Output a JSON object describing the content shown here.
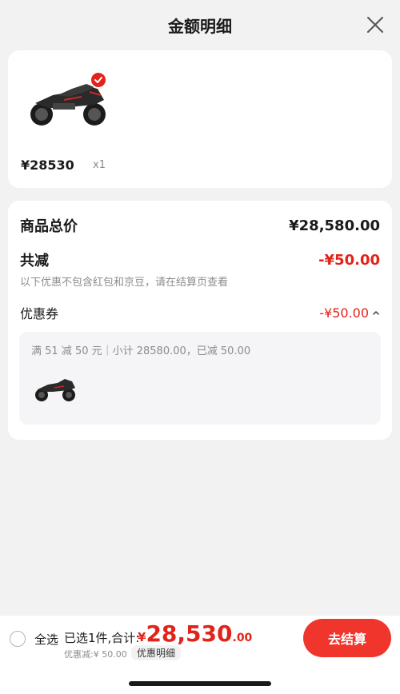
{
  "header": {
    "title": "金额明细"
  },
  "product": {
    "price": "¥28530",
    "qty": "x1",
    "image_icon": "motorcycle-image"
  },
  "summary": {
    "total_label": "商品总价",
    "total_value": "¥28,580.00",
    "discount_label": "共减",
    "discount_value": "-¥50.00",
    "discount_note": "以下优惠不包含红包和京豆，请在结算页查看",
    "coupon_label": "优惠券",
    "coupon_value": "-¥50.00",
    "coupon_desc": "满 51 减 50 元｜小计 28580.00，已减 50.00"
  },
  "bottom": {
    "select_all": "全选",
    "selected_text": "已选1件,合计:",
    "currency": "¥",
    "total_int": "28,530",
    "total_dec": ".00",
    "discount_line": "优惠减:¥ 50.00",
    "detail_link": "优惠明细",
    "checkout_label": "去结算"
  },
  "colors": {
    "accent_red": "#e2231a",
    "button_red": "#f0352c",
    "background": "#f2f2f2"
  }
}
